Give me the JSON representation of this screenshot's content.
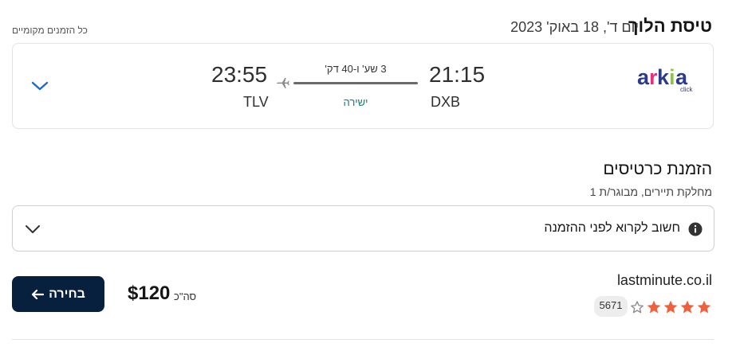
{
  "header": {
    "title": "טיסת הלוך",
    "date": "יום ד', 18 באוק' 2023",
    "note": "כל הזמנים מקומיים"
  },
  "flight": {
    "airline_logo": "arkia",
    "airline_logo_sub": "click",
    "departure_time": "21:15",
    "departure_code": "DXB",
    "arrival_time": "23:55",
    "arrival_code": "TLV",
    "duration": "3 שע' ו-40 דק'",
    "stops": "ישירה",
    "expand_icon": "chevron-down-icon"
  },
  "booking": {
    "title": "הזמנת כרטיסים",
    "subtitle": "מחלקת תיירים, מבוגר/ת 1",
    "notice": "חשוב לקרוא לפני ההזמנה",
    "notice_icon": "info-icon",
    "notice_expand_icon": "chevron-down-icon"
  },
  "offer": {
    "provider": "lastminute.co.il",
    "rating_stars": 4,
    "rating_max": 5,
    "reviews_count": "5671",
    "price": "$120",
    "total_label": "סה\"כ",
    "select_label": "בחירה",
    "select_icon": "arrow-left-icon"
  },
  "colors": {
    "accent_dark": "#06203e",
    "stars": "#f1603c",
    "direct": "#1a7a73",
    "chevron": "#1a6ad8"
  }
}
